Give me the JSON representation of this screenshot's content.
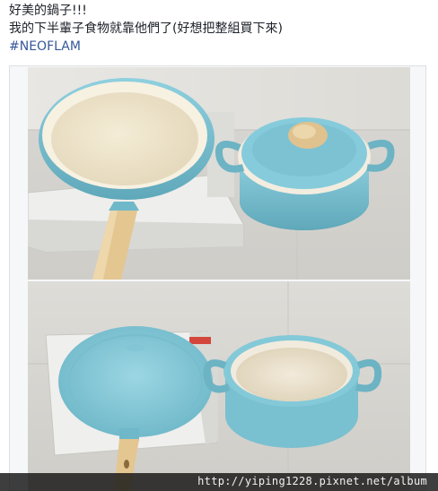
{
  "post": {
    "line1": "好美的鍋子!!!",
    "line2": "我的下半輩子食物就靠他們了(好想把整組買下來)",
    "hashtag": "#NEOFLAM"
  },
  "photos": [
    {
      "subject": "turquoise frying pan with cream interior and wooden handle, turquoise casserole pot with lid"
    },
    {
      "subject": "turquoise frying pan bottom side, open turquoise casserole pot showing cream interior"
    }
  ],
  "colors": {
    "pan_blue": "#7fc6d6",
    "pan_cream": "#efe6cf",
    "handle_wood": "#e4c690",
    "hashtag_link": "#365899"
  },
  "watermark": {
    "text": "http://yiping1228.pixnet.net/album"
  }
}
